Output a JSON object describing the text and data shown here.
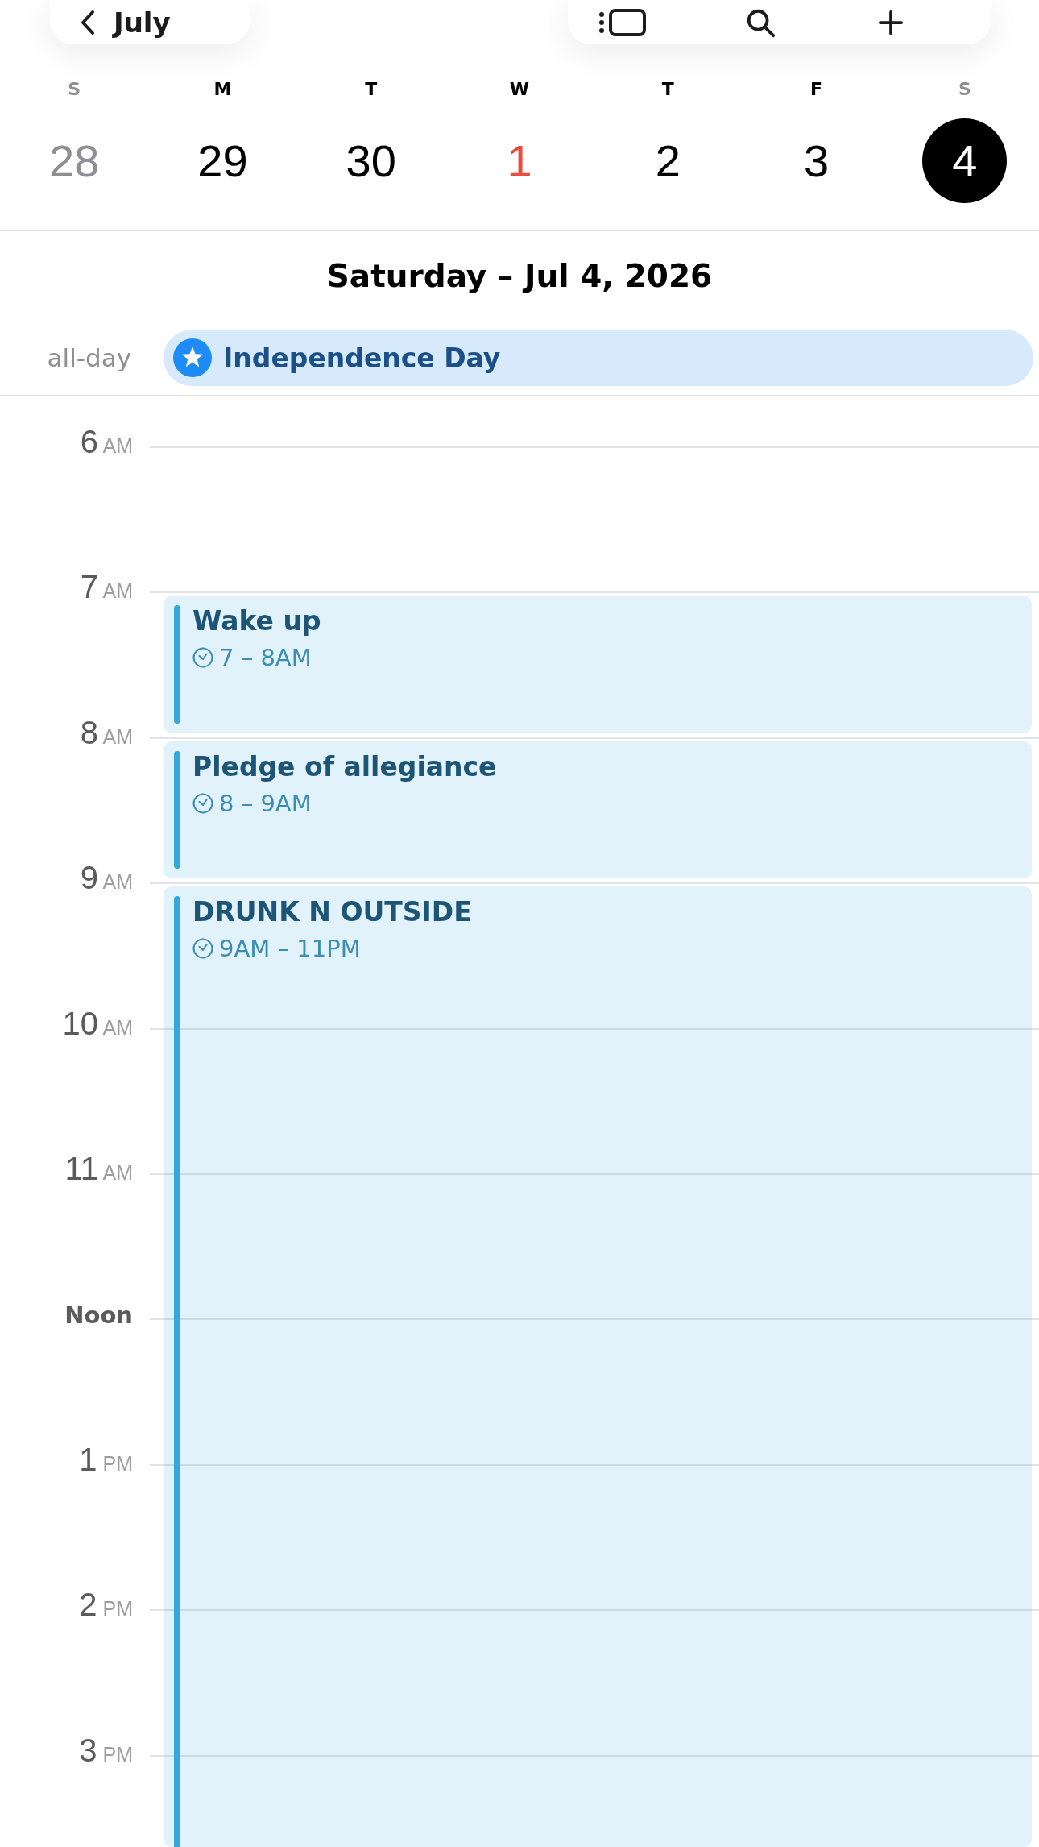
{
  "toolbar": {
    "back_label": "July"
  },
  "days": [
    {
      "weekday": "S",
      "date": "28",
      "weekend": true,
      "today": false,
      "selected": false
    },
    {
      "weekday": "M",
      "date": "29",
      "weekend": false,
      "today": false,
      "selected": false
    },
    {
      "weekday": "T",
      "date": "30",
      "weekend": false,
      "today": false,
      "selected": false
    },
    {
      "weekday": "W",
      "date": "1",
      "weekend": false,
      "today": true,
      "selected": false
    },
    {
      "weekday": "T",
      "date": "2",
      "weekend": false,
      "today": false,
      "selected": false
    },
    {
      "weekday": "F",
      "date": "3",
      "weekend": false,
      "today": false,
      "selected": false
    },
    {
      "weekday": "S",
      "date": "4",
      "weekend": true,
      "today": false,
      "selected": true
    }
  ],
  "day_heading": "Saturday – Jul 4, 2026",
  "all_day": {
    "label": "all-day",
    "events": [
      {
        "title": "Independence Day"
      }
    ]
  },
  "timeline": {
    "hours": [
      {
        "kind": "hour",
        "label": "6",
        "period": "AM"
      },
      {
        "kind": "hour",
        "label": "7",
        "period": "AM",
        "events": [
          {
            "title": "Wake up",
            "time": "7 – 8AM",
            "extends_below": false
          }
        ]
      },
      {
        "kind": "hour",
        "label": "8",
        "period": "AM",
        "events": [
          {
            "title": "Pledge of allegiance",
            "time": "8 – 9AM",
            "extends_below": false
          }
        ]
      },
      {
        "kind": "hour",
        "label": "9",
        "period": "AM",
        "events": [
          {
            "title": "DRUNK N OUTSIDE",
            "time": "9AM – 11PM",
            "extends_below": true
          }
        ]
      },
      {
        "kind": "hour",
        "label": "10",
        "period": "AM"
      },
      {
        "kind": "hour",
        "label": "11",
        "period": "AM"
      },
      {
        "kind": "named",
        "label": "Noon"
      },
      {
        "kind": "hour",
        "label": "1",
        "period": "PM"
      },
      {
        "kind": "hour",
        "label": "2",
        "period": "PM"
      },
      {
        "kind": "hour",
        "label": "3",
        "period": "PM"
      }
    ]
  }
}
